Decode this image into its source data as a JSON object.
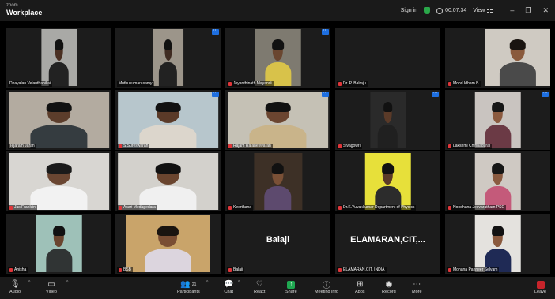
{
  "titlebar": {
    "brand_top": "zoom",
    "brand": "Workplace",
    "signin": "Sign in",
    "timer": "00:07:34",
    "view": "View",
    "minimize": "–",
    "restore": "❐",
    "close": "✕"
  },
  "participants": [
    {
      "name": "Dhayalan Velauthapillai",
      "muted": false,
      "menu": false
    },
    {
      "name": "Muthukumarasamy",
      "muted": false,
      "menu": true
    },
    {
      "name": "Jeyanthinath Mayandi",
      "muted": true,
      "menu": true
    },
    {
      "name": "Dr. P. Balraju",
      "muted": true,
      "menu": false
    },
    {
      "name": "Mohd Idham B",
      "muted": true,
      "menu": false
    },
    {
      "name": "Tejaram Jaran",
      "muted": false,
      "menu": false
    },
    {
      "name": "S.Sureswaran",
      "muted": true,
      "menu": true
    },
    {
      "name": "Rajam Rajaheswaran",
      "muted": true,
      "menu": true
    },
    {
      "name": "Sivagowri",
      "muted": true,
      "menu": true
    },
    {
      "name": "Lakshmi Chinnadurai",
      "muted": true,
      "menu": true
    },
    {
      "name": "Jas Franklin",
      "muted": true,
      "menu": false
    },
    {
      "name": "Asari Medagedara",
      "muted": true,
      "menu": false
    },
    {
      "name": "Keerthana",
      "muted": true,
      "menu": false
    },
    {
      "name": "Dr.K.Yuvakkumar Department of Physics",
      "muted": true,
      "menu": false
    },
    {
      "name": "Noodhana Jeevaratham PSG",
      "muted": true,
      "menu": false
    },
    {
      "name": "Anisha",
      "muted": true,
      "menu": false
    },
    {
      "name": "BSB",
      "muted": true,
      "menu": false
    },
    {
      "name": "Balaji",
      "muted": true,
      "menu": false,
      "display": "Balaji"
    },
    {
      "name": "ELAMARAN,CIT, INDIA",
      "muted": true,
      "menu": false,
      "display": "ELAMARAN,CIT,..."
    },
    {
      "name": "Mohana Panneer Selvam",
      "muted": true,
      "menu": false
    }
  ],
  "toolbar": {
    "audio": "Audio",
    "video": "Video",
    "participants": "Participants",
    "participants_count": "21",
    "chat": "Chat",
    "react": "React",
    "share": "Share",
    "meeting_info": "Meeting info",
    "apps": "Apps",
    "record": "Record",
    "more": "More",
    "leave": "Leave"
  },
  "colors": {
    "share_green": "#1fa851",
    "leave_red": "#c7242b",
    "menu_blue": "#1e6fe0",
    "mute_red": "#e0363a"
  }
}
